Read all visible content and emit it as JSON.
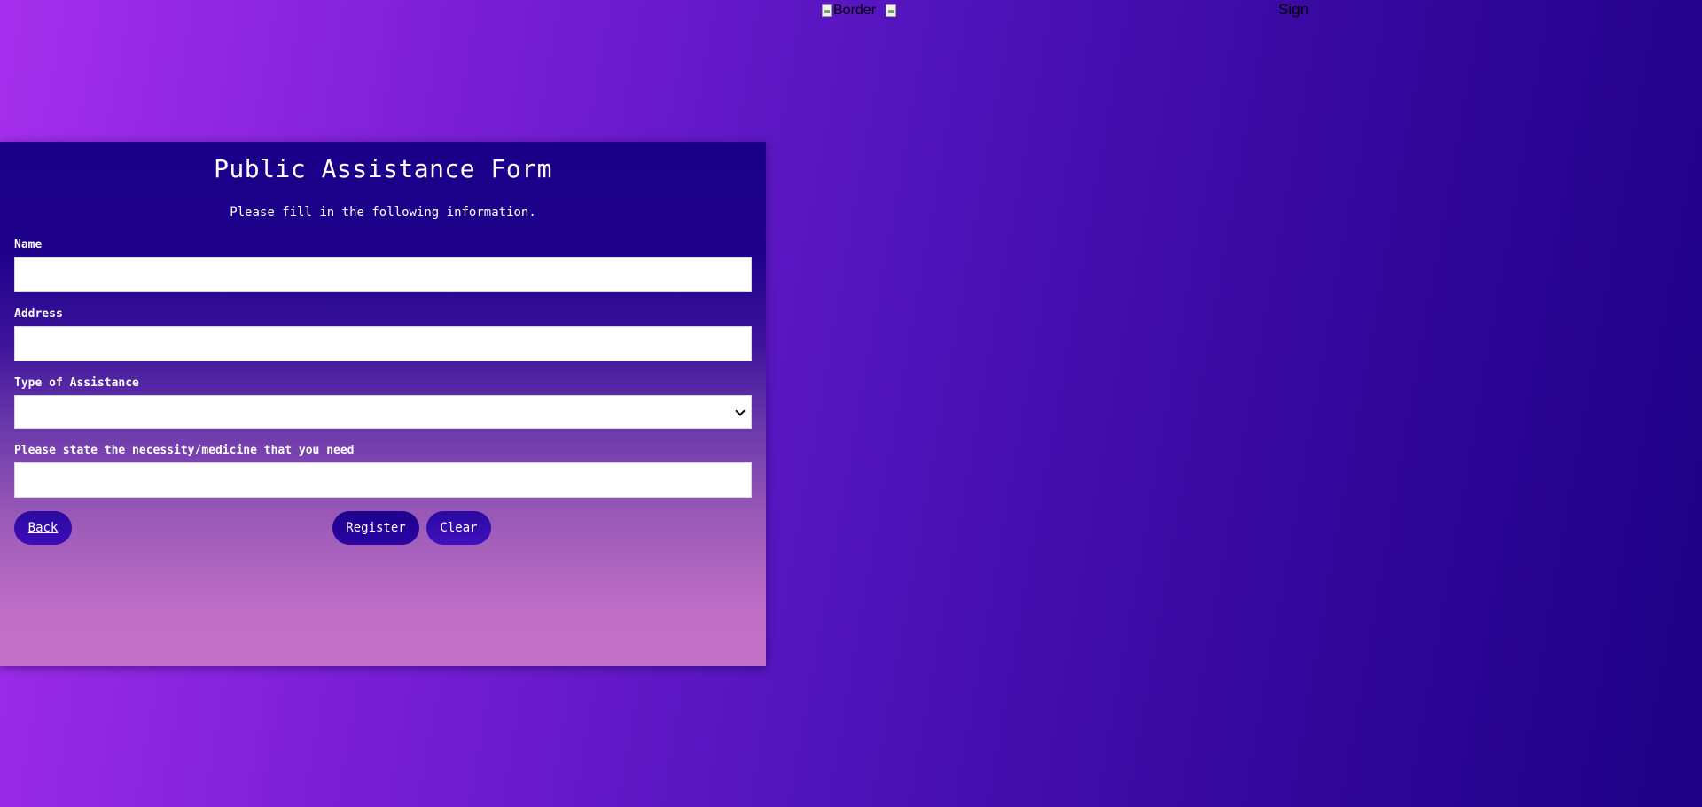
{
  "top": {
    "border_image_alt": "Border",
    "sign_text": "Sign"
  },
  "form": {
    "title": "Public Assistance Form",
    "subtitle": "Please fill in the following information.",
    "fields": {
      "name_label": "Name",
      "name_value": "",
      "address_label": "Address",
      "address_value": "",
      "assistance_type_label": "Type of Assistance",
      "assistance_type_selected": "",
      "necessity_label": "Please state the necessity/medicine that you need",
      "necessity_value": ""
    },
    "buttons": {
      "back": "Back",
      "register": "Register",
      "clear": "Clear"
    }
  },
  "colors": {
    "page_gradient_start": "#a52fec",
    "page_gradient_end": "#1c0085",
    "card_top": "#1a0089",
    "card_bottom": "#c26fc8",
    "button": "#1d008c"
  }
}
